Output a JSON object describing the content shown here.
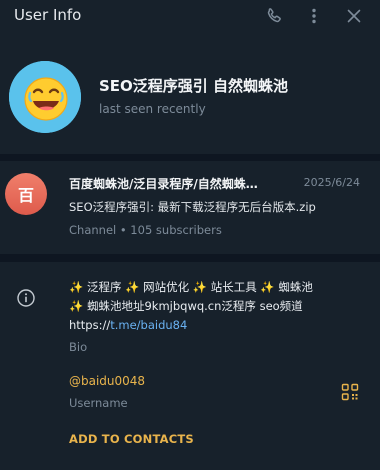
{
  "header": {
    "title": "User Info",
    "icons": [
      "phone-icon",
      "more-vertical-icon",
      "close-icon"
    ]
  },
  "profile": {
    "name": "SEO泛程序强引 自然蜘蛛池",
    "status": "last seen recently",
    "avatar_icon": "laughing-face-icon"
  },
  "channel": {
    "avatar_letter": "百",
    "title": "百度蜘蛛池/泛目录程序/自然蜘蛛…",
    "date": "2025/6/24",
    "message": "SEO泛程序强引: 最新下载泛程序无后台版本.zip",
    "subtitle": "Channel • 105 subscribers"
  },
  "info": {
    "bio_line1": "✨ 泛程序 ✨ 网站优化 ✨ 站长工具 ✨ 蜘蛛池",
    "bio_line2": "✨ 蜘蛛池地址9kmjbqwq.cn泛程序 seo频道",
    "bio_link_prefix": "https://",
    "bio_link": "t.me/baidu84",
    "bio_label": "Bio",
    "username": "@baidu0048",
    "username_label": "Username",
    "add_contacts": "ADD TO CONTACTS"
  },
  "colors": {
    "accent": "#e9b44c",
    "link": "#6ab2f2",
    "muted": "#7d8b99",
    "panel": "#17212b",
    "separator": "#0e1621"
  }
}
